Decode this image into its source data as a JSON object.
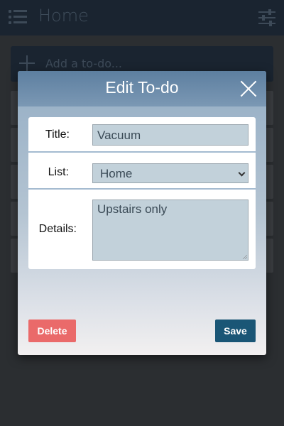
{
  "app": {
    "title": "Home",
    "add_placeholder": "Add a to-do...",
    "list_items": 5
  },
  "modal": {
    "title": "Edit To-do",
    "fields": {
      "title_label": "Title:",
      "title_value": "Vacuum",
      "list_label": "List:",
      "list_value": "Home",
      "details_label": "Details:",
      "details_value": "Upstairs only"
    },
    "buttons": {
      "delete": "Delete",
      "save": "Save"
    }
  },
  "colors": {
    "header_bg": "#1a2430",
    "modal_header": "#5d7fa0",
    "field_bg": "#c2d1da",
    "delete": "#ea6a6a",
    "save": "#1a5676"
  },
  "icons": [
    "menu-icon",
    "filter-icon",
    "plus-icon",
    "close-icon",
    "chevron-down-icon"
  ]
}
